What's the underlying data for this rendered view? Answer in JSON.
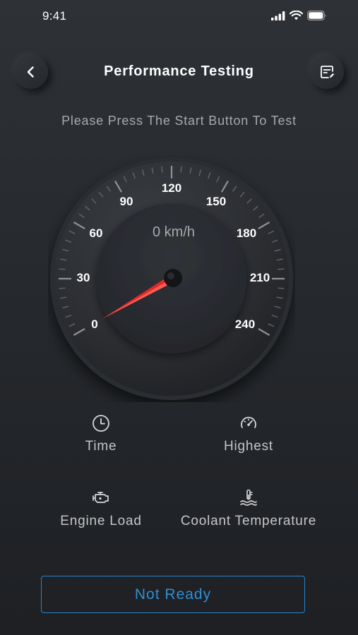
{
  "status_bar": {
    "time": "9:41",
    "icons": [
      "cellular-signal-icon",
      "wifi-icon",
      "battery-icon"
    ]
  },
  "header": {
    "title": "Performance Testing",
    "back_icon": "chevron-left-icon",
    "report_icon": "report-edit-icon"
  },
  "instruction": "Please Press The Start Button To Test",
  "gauge": {
    "speed_readout": "0 km/h",
    "current_speed": 0,
    "min": 0,
    "max": 240,
    "scale_labels": [
      "0",
      "30",
      "60",
      "90",
      "120",
      "150",
      "180",
      "210",
      "240"
    ],
    "needle_color": "#e02a2a"
  },
  "metrics": {
    "time": {
      "label": "Time",
      "icon": "clock-icon"
    },
    "highest": {
      "label": "Highest",
      "icon": "speedometer-icon"
    },
    "engine_load": {
      "label": "Engine Load",
      "icon": "engine-icon"
    },
    "coolant_temperature": {
      "label": "Coolant Temperature",
      "icon": "thermometer-icon"
    }
  },
  "action_button": {
    "label": "Not Ready",
    "accent_color": "#2f8fd6"
  }
}
